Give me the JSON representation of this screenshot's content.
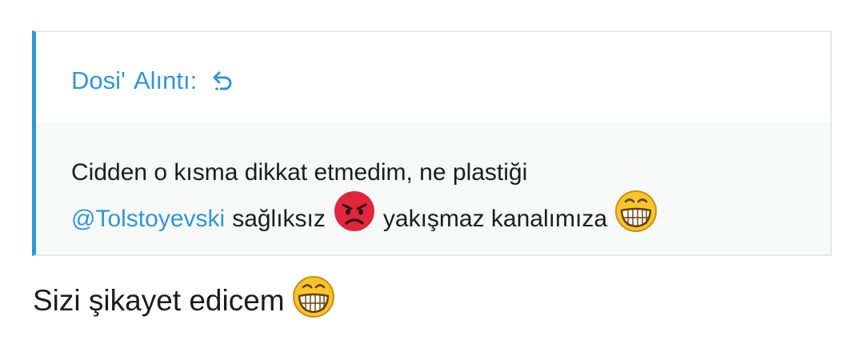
{
  "quote": {
    "author": "Dosi'",
    "header_suffix": "Alıntı:",
    "icon": "reply-arrow-icon",
    "line1": "Cidden o kısma dikkat etmedim, ne plastiği",
    "mention": "@Tolstoyevski",
    "word1": "sağlıksız",
    "emoji1": "angry-face-icon",
    "word2": "yakışmaz kanalımıza",
    "emoji2": "grinning-face-icon"
  },
  "reply": {
    "text": "Sizi şikayet edicem",
    "emoji": "grinning-face-icon"
  },
  "colors": {
    "accent": "#2f97d6",
    "quote_bar": "#2c9ad8",
    "quote_bg": "#f7f8f8",
    "angry": "#e0263d",
    "grin": "#f6c52c"
  }
}
